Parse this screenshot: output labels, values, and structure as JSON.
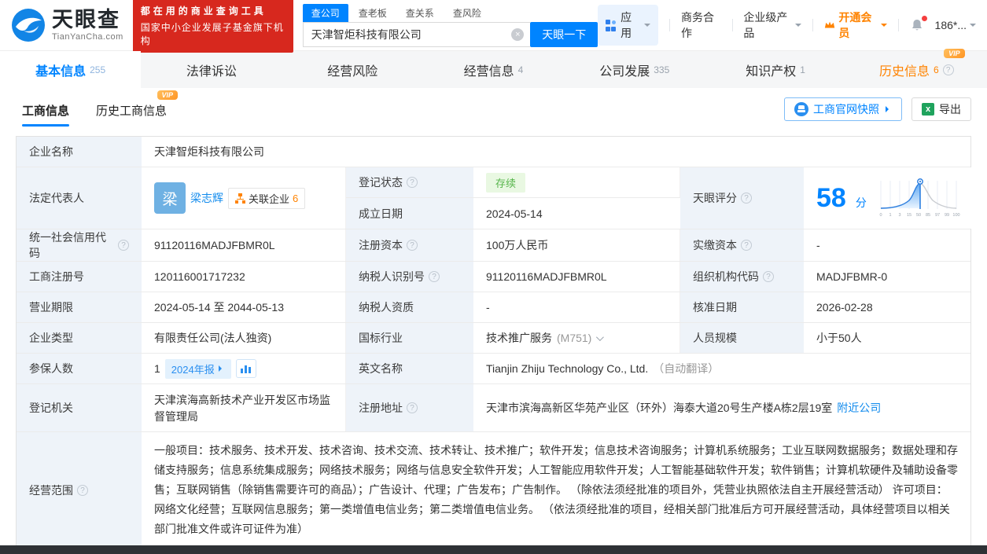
{
  "common": {
    "vip": "VIP"
  },
  "header": {
    "logo_title": "天眼查",
    "logo_domain": "TianYanCha.com",
    "slogan_line1": "都在用的商业查询工具",
    "slogan_line2": "国家中小企业发展子基金旗下机构",
    "search_tabs": [
      "查公司",
      "查老板",
      "查关系",
      "查风险"
    ],
    "search_value": "天津智炬科技有限公司",
    "search_button": "天眼一下",
    "nav_apps": "应用",
    "nav_cooperation": "商务合作",
    "nav_enterprise": "企业级产品",
    "nav_vip": "开通会员",
    "nav_phone": "186*..."
  },
  "tabs": [
    {
      "label": "基本信息",
      "count": "255"
    },
    {
      "label": "法律诉讼",
      "count": ""
    },
    {
      "label": "经营风险",
      "count": ""
    },
    {
      "label": "经营信息",
      "count": "4"
    },
    {
      "label": "公司发展",
      "count": "335"
    },
    {
      "label": "知识产权",
      "count": "1"
    },
    {
      "label": "历史信息",
      "count": "6"
    }
  ],
  "subtabs": {
    "primary": "工商信息",
    "secondary": "历史工商信息",
    "snapshot_button": "工商官网快照",
    "export_button": "导出"
  },
  "info": {
    "company_name": {
      "label": "企业名称",
      "value": "天津智炬科技有限公司"
    },
    "legal_rep": {
      "label": "法定代表人",
      "avatar_char": "梁",
      "name": "梁志辉",
      "related_label": "关联企业",
      "related_count": "6"
    },
    "reg_status": {
      "label": "登记状态",
      "value": "存续"
    },
    "establish_date": {
      "label": "成立日期",
      "value": "2024-05-14"
    },
    "score": {
      "label": "天眼评分",
      "value": "58",
      "unit": "分",
      "axis": "0 1 3 15 50 85 97 99 100"
    },
    "credit_code": {
      "label": "统一社会信用代码",
      "value": "91120116MADJFBMR0L"
    },
    "reg_capital": {
      "label": "注册资本",
      "value": "100万人民币"
    },
    "paid_capital": {
      "label": "实缴资本",
      "value": "-"
    },
    "reg_number": {
      "label": "工商注册号",
      "value": "120116001717232"
    },
    "taxpayer_id": {
      "label": "纳税人识别号",
      "value": "91120116MADJFBMR0L"
    },
    "org_code": {
      "label": "组织机构代码",
      "value": "MADJFBMR-0"
    },
    "business_term": {
      "label": "营业期限",
      "value": "2024-05-14 至 2044-05-13"
    },
    "taxpayer_quality": {
      "label": "纳税人资质",
      "value": "-"
    },
    "approval_date": {
      "label": "核准日期",
      "value": "2026-02-28"
    },
    "company_type": {
      "label": "企业类型",
      "value": "有限责任公司(法人独资)"
    },
    "industry": {
      "label": "国标行业",
      "value": "技术推广服务",
      "code": "(M751)"
    },
    "staff_size": {
      "label": "人员规模",
      "value": "小于50人"
    },
    "insured": {
      "label": "参保人数",
      "value": "1",
      "report_badge": "2024年报"
    },
    "english_name": {
      "label": "英文名称",
      "value": "Tianjin Zhiju Technology Co., Ltd.",
      "note": "（自动翻译）"
    },
    "reg_authority": {
      "label": "登记机关",
      "value": "天津滨海高新技术产业开发区市场监督管理局"
    },
    "reg_address": {
      "label": "注册地址",
      "value": "天津市滨海高新区华苑产业区（环外）海泰大道20号生产楼A栋2层19室",
      "link": "附近公司"
    },
    "business_scope": {
      "label": "经营范围",
      "value": "一般项目：技术服务、技术开发、技术咨询、技术交流、技术转让、技术推广；软件开发；信息技术咨询服务；计算机系统服务；工业互联网数据服务；数据处理和存储支持服务；信息系统集成服务；网络技术服务；网络与信息安全软件开发；人工智能应用软件开发；人工智能基础软件开发；软件销售；计算机软硬件及辅助设备零售；互联网销售（除销售需要许可的商品）；广告设计、代理；广告发布；广告制作。 （除依法须经批准的项目外，凭营业执照依法自主开展经营活动） 许可项目：网络文化经营；互联网信息服务；第一类增值电信业务；第二类增值电信业务。 （依法须经批准的项目，经相关部门批准后方可开展经营活动，具体经营项目以相关部门批准文件或许可证件为准）"
    }
  }
}
